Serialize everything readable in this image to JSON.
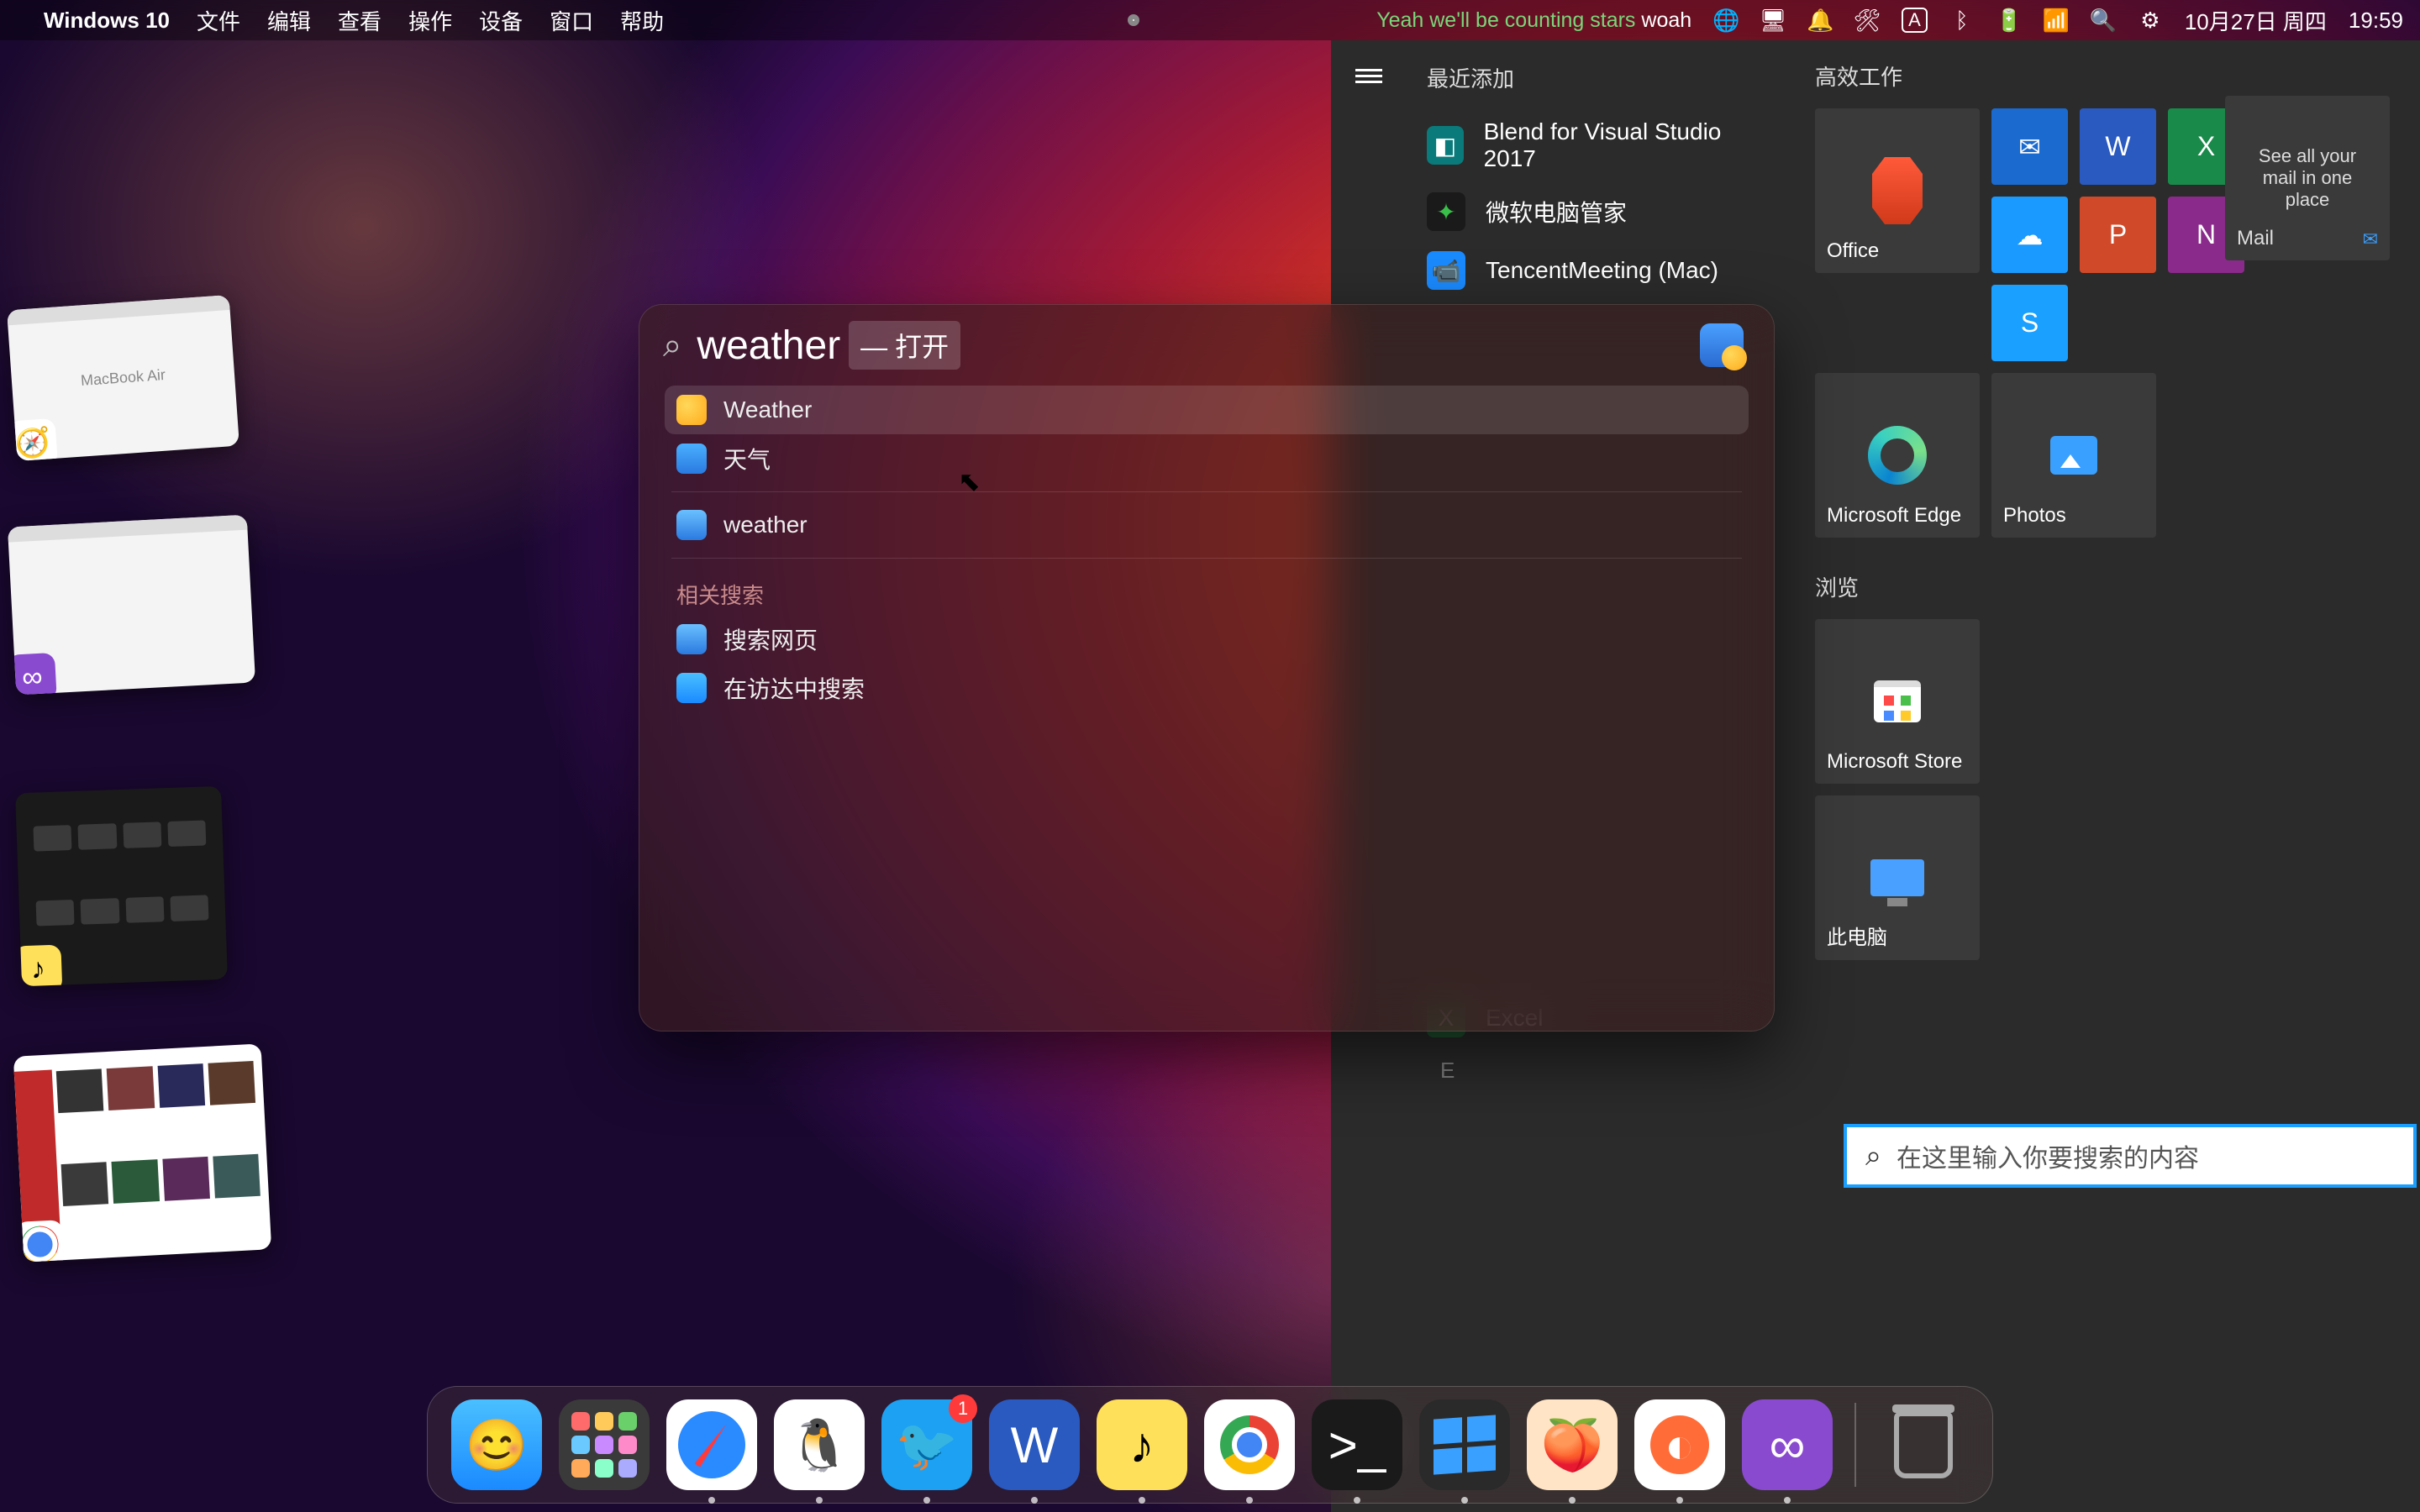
{
  "menubar": {
    "app": "Windows 10",
    "items": [
      "文件",
      "编辑",
      "查看",
      "操作",
      "设备",
      "窗口",
      "帮助"
    ],
    "song_main": "Yeah we'll be counting stars",
    "song_trail": "woah",
    "boxed_letter": "A",
    "battery_text": "",
    "date": "10月27日 周四",
    "time": "19:59"
  },
  "spotlight": {
    "query": "weather",
    "hint": "— 打开",
    "results": [
      {
        "label": "Weather",
        "icon": "weather-sun"
      },
      {
        "label": "天气",
        "icon": "weather-blue"
      }
    ],
    "tertiary": {
      "label": "weather",
      "icon": "safari"
    },
    "related_label": "相关搜索",
    "related": [
      {
        "label": "搜索网页",
        "icon": "safari"
      },
      {
        "label": "在访达中搜索",
        "icon": "finder"
      }
    ]
  },
  "startmenu": {
    "recent_label": "最近添加",
    "recent": [
      {
        "label": "Blend for Visual Studio 2017",
        "color": "#0aa0a0"
      },
      {
        "label": "微软电脑管家",
        "color": "#3ac04a"
      },
      {
        "label": "TencentMeeting (Mac)",
        "color": "#1a8aff"
      }
    ],
    "bottom_app": {
      "letter": "E",
      "label": "Excel"
    },
    "group1_label": "高效工作",
    "group2_label": "浏览",
    "tiles": {
      "office": "Office",
      "edge": "Microsoft Edge",
      "photos": "Photos",
      "mail_text": "See all your mail in one place",
      "mail_label": "Mail",
      "store": "Microsoft Store",
      "thispc": "此电脑"
    },
    "search_placeholder": "在这里输入你要搜索的内容"
  },
  "dock": {
    "items": [
      "finder",
      "launchpad",
      "safari",
      "qq",
      "twitter",
      "word",
      "qqmusic",
      "chrome",
      "terminal",
      "windows",
      "peach",
      "postman",
      "vs"
    ],
    "twitter_badge": "1",
    "running": [
      "safari",
      "qq",
      "twitter",
      "word",
      "qqmusic",
      "chrome",
      "terminal",
      "windows",
      "peach",
      "postman",
      "vs"
    ]
  },
  "thumbs": {
    "t1": "MacBook Air",
    "count": 4
  }
}
